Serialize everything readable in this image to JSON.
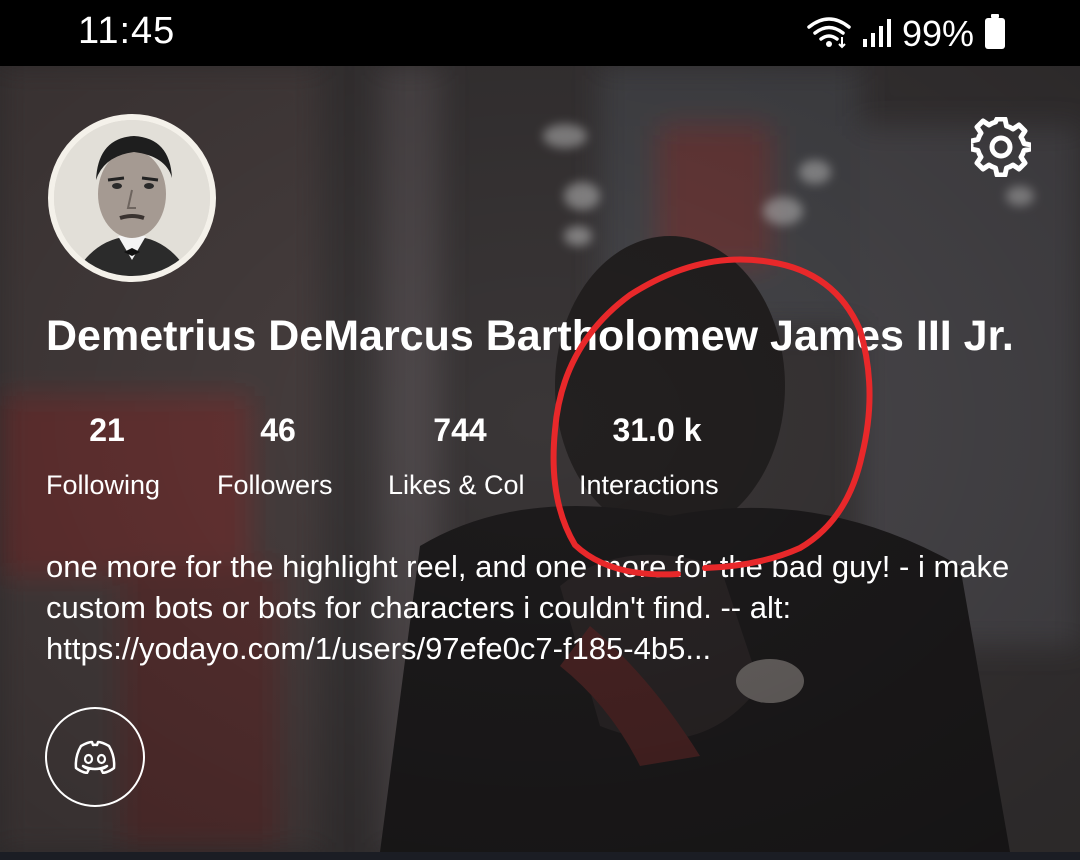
{
  "status_bar": {
    "time": "11:45",
    "battery_text": "99%",
    "icons": [
      "wifi-icon",
      "signal-icon",
      "battery-icon"
    ]
  },
  "profile": {
    "display_name": "Demetrius DeMarcus Bartholomew James III Jr.",
    "stats": [
      {
        "value": "21",
        "label": "Following"
      },
      {
        "value": "46",
        "label": "Followers"
      },
      {
        "value": "744",
        "label": "Likes & Col"
      },
      {
        "value": "31.0 k",
        "label": "Interactions"
      }
    ],
    "bio": "one more for the highlight reel, and one more for the bad guy! - i make custom bots or bots for characters i couldn't find. -- alt: https://yodayo.com/1/users/97efe0c7-f185-4b5...",
    "icons": [
      "gear-icon",
      "discord-icon"
    ]
  },
  "colors": {
    "annotation": "#e8282a",
    "text": "#ffffff",
    "background": "#3b3839"
  }
}
